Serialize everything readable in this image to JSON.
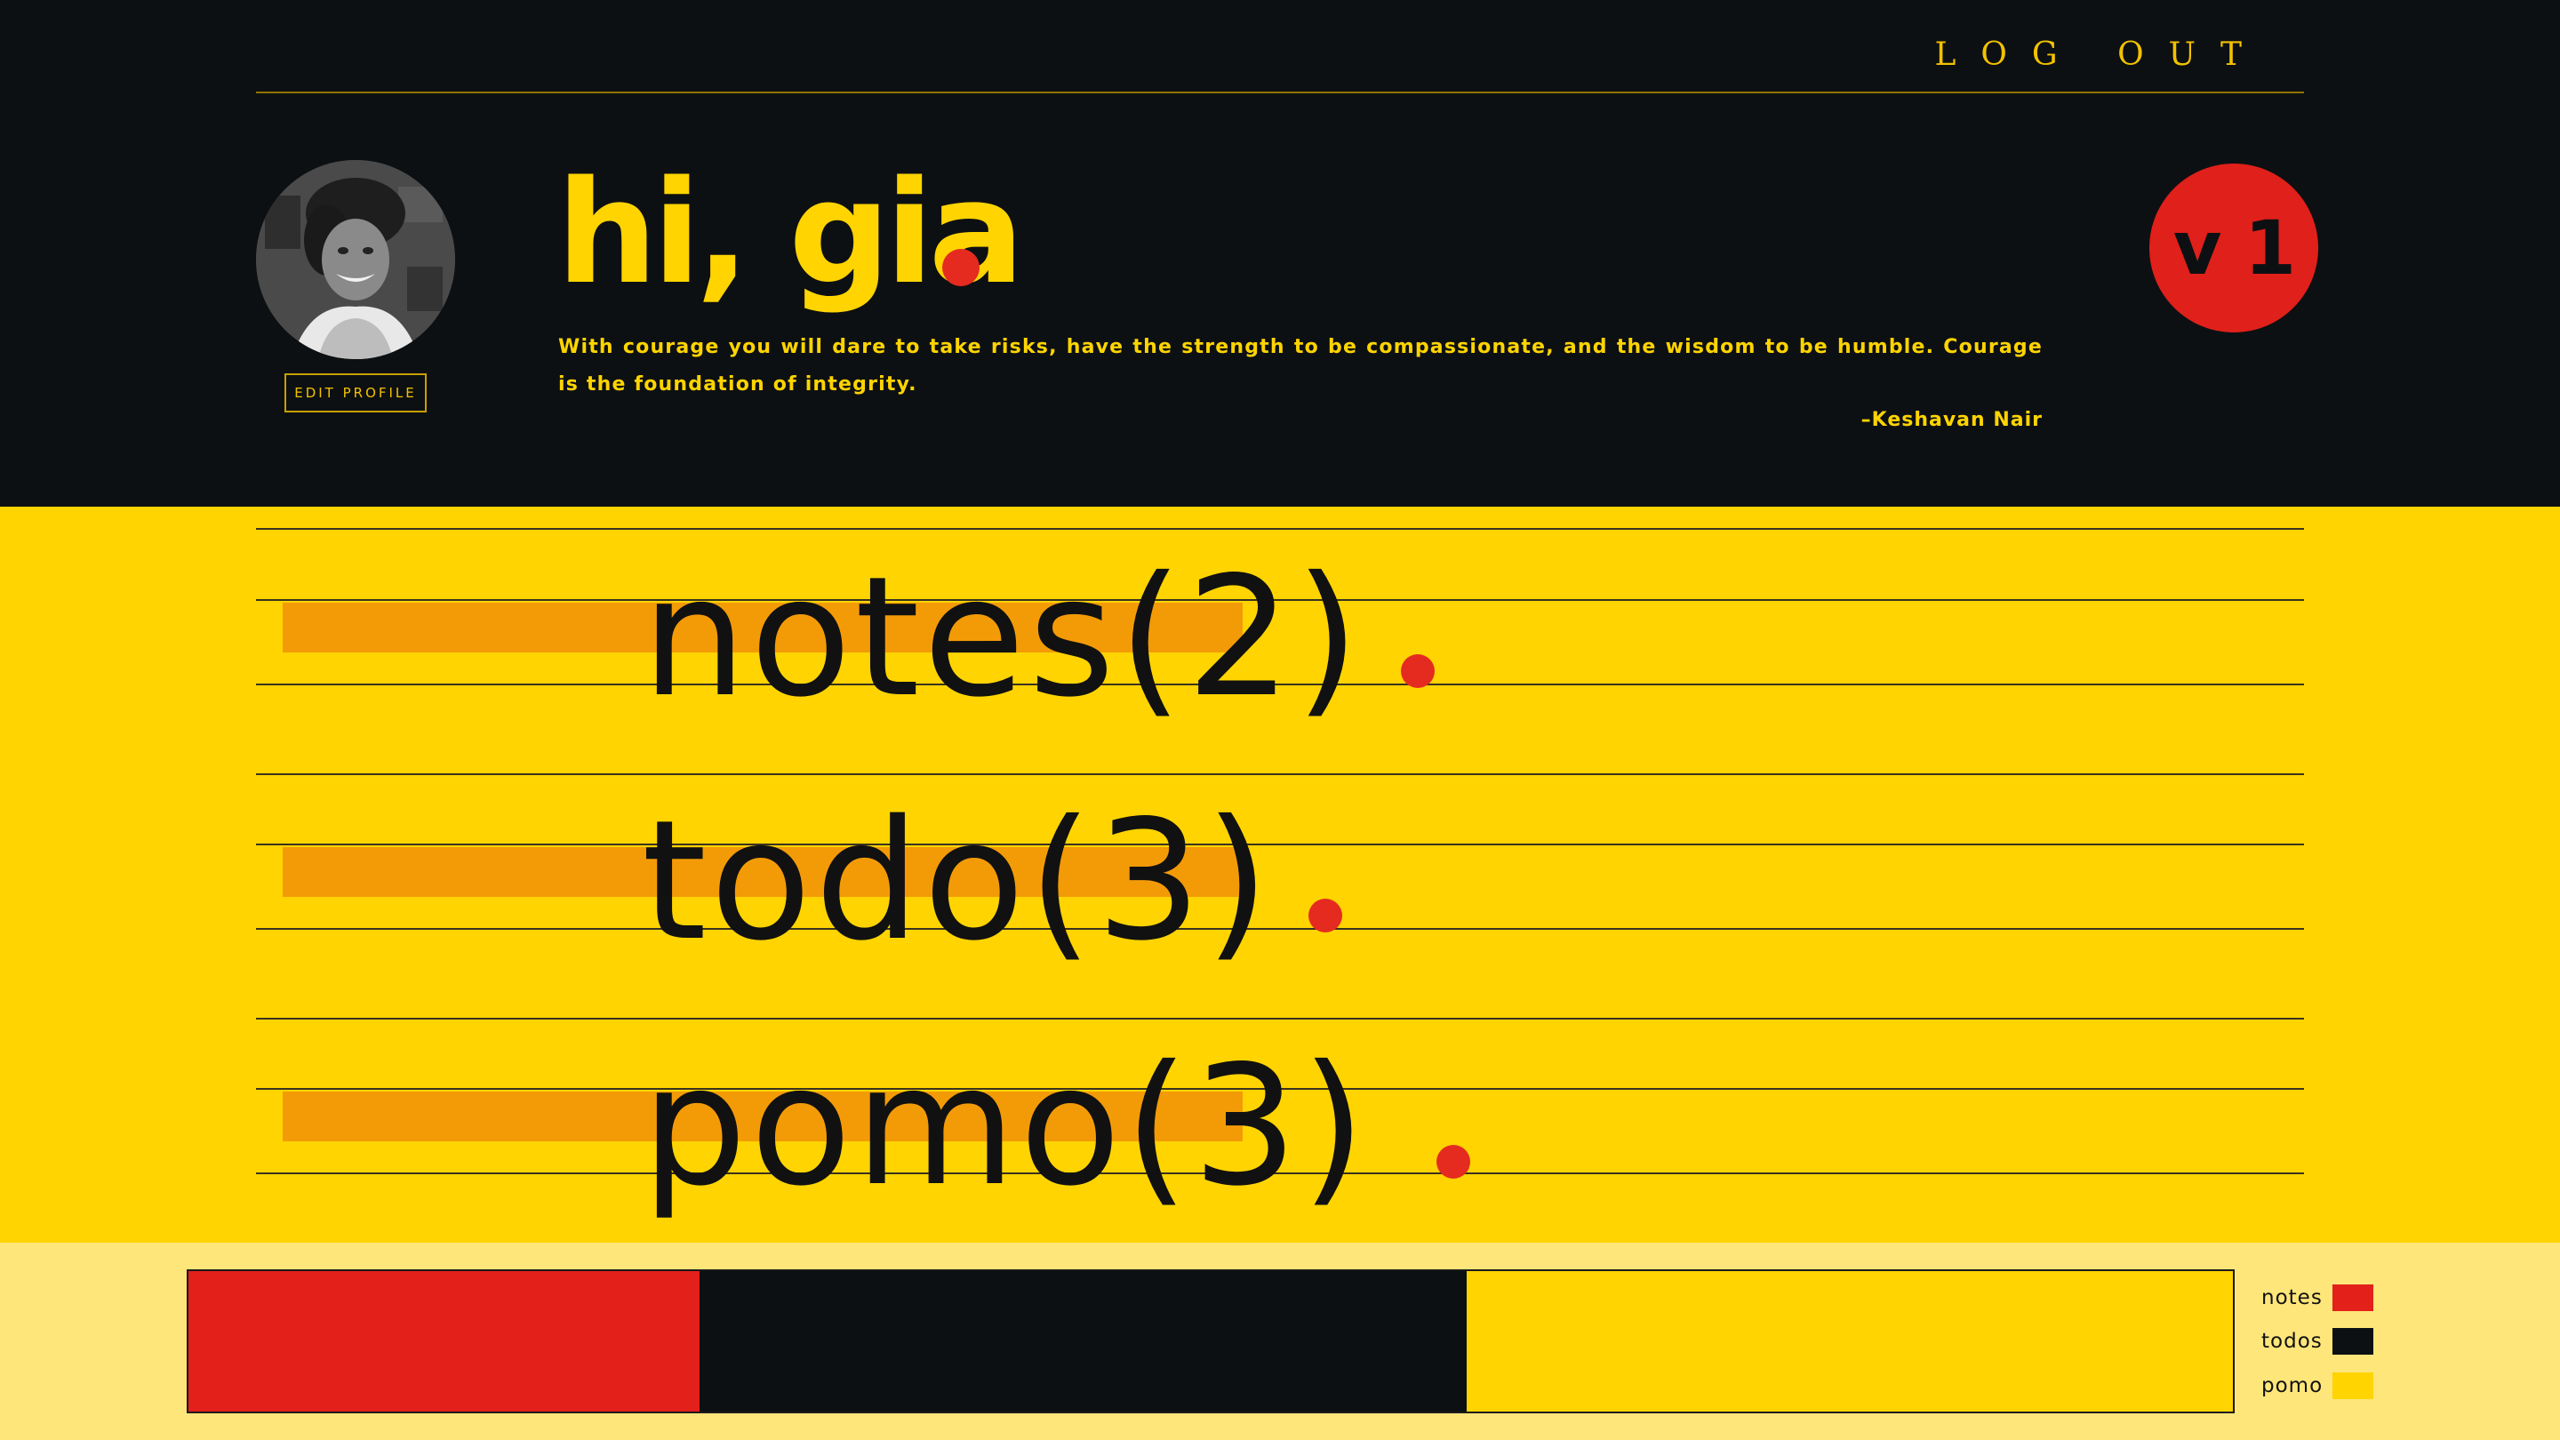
{
  "header": {
    "logout_label": "LOG OUT",
    "edit_profile_label": "EDIT PROFILE",
    "greeting": "hi, gia",
    "quote": "With courage you will dare to take risks, have the strength to be compassionate, and the wisdom to be humble. Courage is the foundation of integrity.",
    "author": "–Keshavan Nair",
    "version": "v 1"
  },
  "sections": [
    {
      "label": "notes(2)"
    },
    {
      "label": "todo(3)"
    },
    {
      "label": "pomo(3)"
    }
  ],
  "chart_data": {
    "type": "bar",
    "categories": [
      "notes",
      "todos",
      "pomo"
    ],
    "values": [
      2,
      3,
      3
    ],
    "colors": [
      "#e3201a",
      "#0d1012",
      "#ffd400"
    ],
    "legend_position": "right"
  },
  "legend": [
    {
      "label": "notes",
      "color": "#e3201a"
    },
    {
      "label": "todos",
      "color": "#0d1012"
    },
    {
      "label": "pomo",
      "color": "#ffd400"
    }
  ],
  "colors": {
    "dark": "#0d1012",
    "yellow": "#ffd400",
    "red": "#e52b20",
    "orange": "#f39b07",
    "pale_yellow": "#ffe67a"
  }
}
